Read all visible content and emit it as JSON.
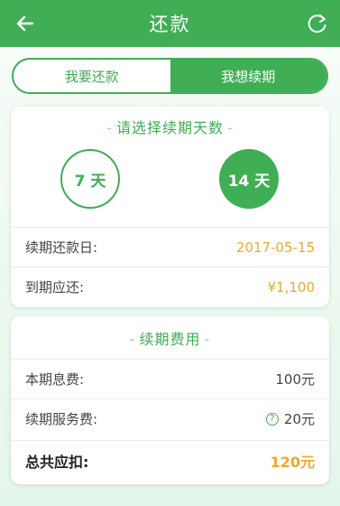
{
  "header": {
    "title": "还款",
    "back_icon": "arrow-left-icon",
    "refresh_icon": "refresh-icon"
  },
  "tabs": [
    {
      "label": "我要还款",
      "selected": false
    },
    {
      "label": "我想续期",
      "selected": true
    }
  ],
  "renewal": {
    "section_title": "请选择续期天数",
    "options": [
      {
        "label": "7 天",
        "selected": false
      },
      {
        "label": "14 天",
        "selected": true
      }
    ],
    "due_date_label": "续期还款日:",
    "due_date_value": "2017-05-15",
    "amount_due_label": "到期应还:",
    "amount_due_value": "¥1,100"
  },
  "fees": {
    "section_title": "续期费用",
    "interest_label": "本期息费:",
    "interest_value": "100元",
    "service_label": "续期服务费:",
    "service_value": "20元",
    "total_label": "总共应扣:",
    "total_value": "120元"
  },
  "colors": {
    "primary": "#3fae55",
    "accent": "#f0a92a"
  }
}
